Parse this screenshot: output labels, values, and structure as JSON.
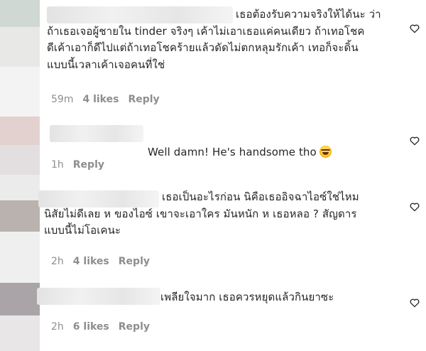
{
  "comments": [
    {
      "text": "เธอต้องรับความจริงให้ได้นะ ว่า\nถ้าเธอเจอผู้ชายใน tinder จริงๆ เค้าไม่เอาเธอแค่คนเดียว ถ้าเทอโชค\nดีเค้าเอาก็ดีไปแต่ถ้าเทอโชคร้ายแล้วดัดไม่ตกหลุมรักเค้า เทอก็จะดิ้น\nแบบนี้เวลาเค้าเจอคนที่ใช่",
      "time": "59m",
      "likes": "4 likes",
      "reply": "Reply",
      "avatar_color": "#c9d3cc"
    },
    {
      "text": "Well damn! He's handsome tho",
      "time": "1h",
      "likes": "",
      "reply": "Reply",
      "avatar_color": "#d9c9c7"
    },
    {
      "text": "เธอเป็นอะไรก่อน นิคือเธออิจฉาไอซ์ใช่ไหม\nนิสัยไม่ดีเลย ห ของไอซ์ เขาจะเอาใคร มันหนัก ห เธอหลอ ? สัญดาร\nแบบนี้ไม่โอเคนะ",
      "time": "2h",
      "likes": "4 likes",
      "reply": "Reply",
      "avatar_color": "#b7b0ad"
    },
    {
      "text": "เพลียใจมาก เธอควรหยุดแล้วกินยาซะ",
      "time": "2h",
      "likes": "6 likes",
      "reply": "Reply",
      "avatar_color": "#a8a2a6"
    }
  ],
  "icons": {
    "like": "heart-outline-icon",
    "reaction": "laughing-tears-emoji"
  }
}
